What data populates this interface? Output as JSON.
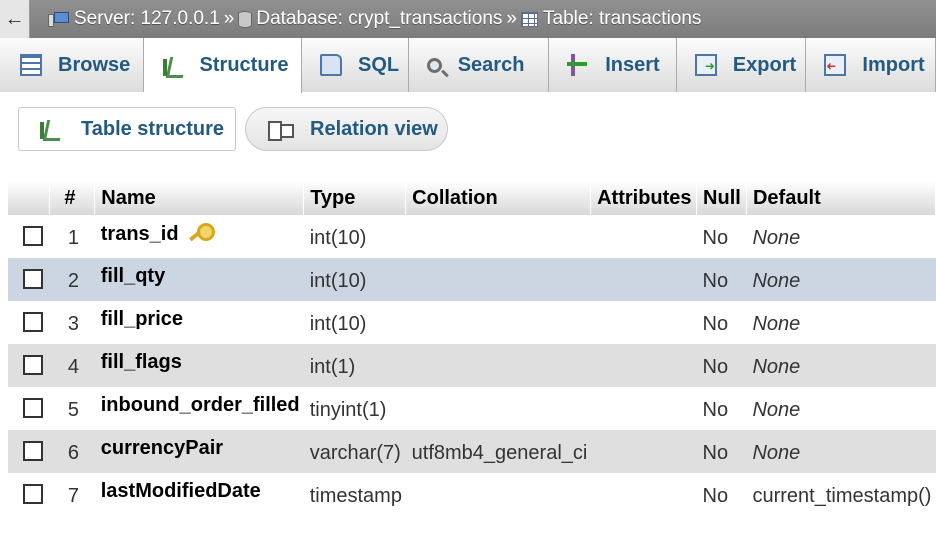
{
  "breadcrumb": {
    "back_glyph": "←",
    "server": "Server: 127.0.0.1",
    "database": "Database: crypt_transactions",
    "table": "Table: transactions",
    "separator": "»"
  },
  "tabs": [
    {
      "label": "Browse",
      "icon": "browse-icon"
    },
    {
      "label": "Structure",
      "icon": "structure-icon",
      "active": true
    },
    {
      "label": "SQL",
      "icon": "sql-icon"
    },
    {
      "label": "Search",
      "icon": "search-icon"
    },
    {
      "label": "Insert",
      "icon": "insert-icon"
    },
    {
      "label": "Export",
      "icon": "export-icon"
    },
    {
      "label": "Import",
      "icon": "import-icon"
    }
  ],
  "subtabs": {
    "table_structure": "Table structure",
    "relation_view": "Relation view"
  },
  "table": {
    "headers": {
      "num": "#",
      "name": "Name",
      "type": "Type",
      "collation": "Collation",
      "attributes": "Attributes",
      "null": "Null",
      "default": "Default"
    },
    "rows": [
      {
        "num": "1",
        "name": "trans_id",
        "type": "int(10)",
        "collation": "",
        "attributes": "",
        "null": "No",
        "default": "None",
        "primary_key": true
      },
      {
        "num": "2",
        "name": "fill_qty",
        "type": "int(10)",
        "collation": "",
        "attributes": "",
        "null": "No",
        "default": "None"
      },
      {
        "num": "3",
        "name": "fill_price",
        "type": "int(10)",
        "collation": "",
        "attributes": "",
        "null": "No",
        "default": "None"
      },
      {
        "num": "4",
        "name": "fill_flags",
        "type": "int(1)",
        "collation": "",
        "attributes": "",
        "null": "No",
        "default": "None"
      },
      {
        "num": "5",
        "name": "inbound_order_filled",
        "type": "tinyint(1)",
        "collation": "",
        "attributes": "",
        "null": "No",
        "default": "None"
      },
      {
        "num": "6",
        "name": "currencyPair",
        "type": "varchar(7)",
        "collation": "utf8mb4_general_ci",
        "attributes": "",
        "null": "No",
        "default": "None"
      },
      {
        "num": "7",
        "name": "lastModifiedDate",
        "type": "timestamp",
        "collation": "",
        "attributes": "",
        "null": "No",
        "default": "current_timestamp()"
      }
    ]
  },
  "colors": {
    "link": "#235a81",
    "row_highlight": "#ccd6e3",
    "row_alt": "#dfdfdf",
    "breadcrumb_bg": "#858585"
  }
}
